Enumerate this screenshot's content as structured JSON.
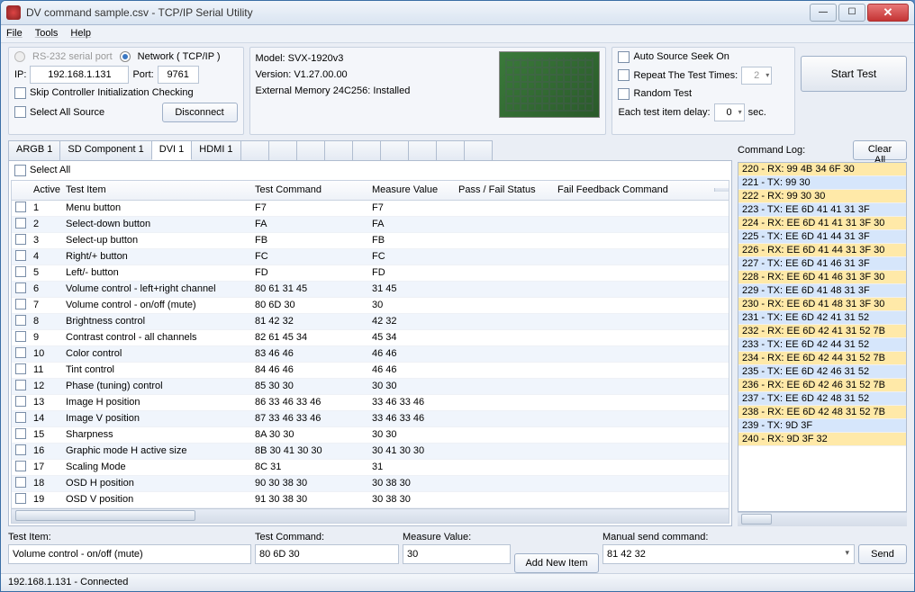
{
  "window": {
    "title": "DV command sample.csv - TCP/IP Serial Utility"
  },
  "menu": {
    "file": "File",
    "tools": "Tools",
    "help": "Help"
  },
  "conn": {
    "rs232": "RS-232 serial port",
    "network": "Network ( TCP/IP )",
    "ip_label": "IP:",
    "ip": "192.168.1.131",
    "port_label": "Port:",
    "port": "9761",
    "skip": "Skip Controller Initialization Checking",
    "selectall_source": "Select All Source",
    "disconnect": "Disconnect"
  },
  "info": {
    "model": "Model: SVX-1920v3",
    "version": "Version: V1.27.00.00",
    "extmem": "External Memory 24C256: Installed"
  },
  "opts": {
    "autoseek": "Auto Source Seek On",
    "repeat": "Repeat The Test Times:",
    "repeat_val": "2",
    "random": "Random Test",
    "delay_label": "Each test item delay:",
    "delay_val": "0",
    "sec": "sec."
  },
  "buttons": {
    "start": "Start Test",
    "clearall": "Clear All",
    "addnew": "Add New Item",
    "send": "Send"
  },
  "tabs": [
    "ARGB 1",
    "SD Component 1",
    "DVI 1",
    "HDMI 1"
  ],
  "active_tab": 2,
  "grid": {
    "selectall": "Select All",
    "headers": {
      "active": "Active",
      "item": "Test Item",
      "cmd": "Test Command",
      "meas": "Measure Value",
      "pass": "Pass / Fail Status",
      "fail": "Fail Feedback Command"
    },
    "rows": [
      {
        "n": "1",
        "item": "Menu button",
        "cmd": "F7",
        "meas": "F7"
      },
      {
        "n": "2",
        "item": "Select-down button",
        "cmd": "FA",
        "meas": "FA"
      },
      {
        "n": "3",
        "item": "Select-up button",
        "cmd": "FB",
        "meas": "FB"
      },
      {
        "n": "4",
        "item": "Right/+ button",
        "cmd": "FC",
        "meas": "FC"
      },
      {
        "n": "5",
        "item": "Left/- button",
        "cmd": "FD",
        "meas": "FD"
      },
      {
        "n": "6",
        "item": "Volume control - left+right channel",
        "cmd": "80 61 31 45",
        "meas": "31 45"
      },
      {
        "n": "7",
        "item": "Volume control - on/off (mute)",
        "cmd": "80 6D 30",
        "meas": "30"
      },
      {
        "n": "8",
        "item": "Brightness control",
        "cmd": "81 42 32",
        "meas": "42 32"
      },
      {
        "n": "9",
        "item": "Contrast control - all channels",
        "cmd": "82 61 45 34",
        "meas": "45 34"
      },
      {
        "n": "10",
        "item": "Color control",
        "cmd": "83 46 46",
        "meas": "46 46"
      },
      {
        "n": "11",
        "item": "Tint control",
        "cmd": "84 46 46",
        "meas": "46 46"
      },
      {
        "n": "12",
        "item": "Phase (tuning) control",
        "cmd": "85 30 30",
        "meas": "30 30"
      },
      {
        "n": "13",
        "item": "Image H position",
        "cmd": "86 33 46 33 46",
        "meas": "33 46 33 46"
      },
      {
        "n": "14",
        "item": "Image V position",
        "cmd": "87 33 46 33 46",
        "meas": "33 46 33 46"
      },
      {
        "n": "15",
        "item": "Sharpness",
        "cmd": "8A 30 30",
        "meas": "30 30"
      },
      {
        "n": "16",
        "item": "Graphic mode H active size",
        "cmd": "8B 30 41 30 30",
        "meas": "30 41 30 30"
      },
      {
        "n": "17",
        "item": "Scaling Mode",
        "cmd": "8C 31",
        "meas": "31"
      },
      {
        "n": "18",
        "item": "OSD H position",
        "cmd": "90 30 38 30",
        "meas": "30 38 30"
      },
      {
        "n": "19",
        "item": "OSD V position",
        "cmd": "91 30 38 30",
        "meas": "30 38 30"
      }
    ]
  },
  "log": {
    "label": "Command Log:",
    "lines": [
      {
        "n": "220",
        "d": "RX",
        "b": "99 4B 34 6F 30"
      },
      {
        "n": "221",
        "d": "TX",
        "b": "99 30"
      },
      {
        "n": "222",
        "d": "RX",
        "b": "99 30 30"
      },
      {
        "n": "223",
        "d": "TX",
        "b": "EE 6D 41 41 31 3F"
      },
      {
        "n": "224",
        "d": "RX",
        "b": "EE 6D 41 41 31 3F 30"
      },
      {
        "n": "225",
        "d": "TX",
        "b": "EE 6D 41 44 31 3F"
      },
      {
        "n": "226",
        "d": "RX",
        "b": "EE 6D 41 44 31 3F 30"
      },
      {
        "n": "227",
        "d": "TX",
        "b": "EE 6D 41 46 31 3F"
      },
      {
        "n": "228",
        "d": "RX",
        "b": "EE 6D 41 46 31 3F 30"
      },
      {
        "n": "229",
        "d": "TX",
        "b": "EE 6D 41 48 31 3F"
      },
      {
        "n": "230",
        "d": "RX",
        "b": "EE 6D 41 48 31 3F 30"
      },
      {
        "n": "231",
        "d": "TX",
        "b": "EE 6D 42 41 31 52"
      },
      {
        "n": "232",
        "d": "RX",
        "b": "EE 6D 42 41 31 52 7B"
      },
      {
        "n": "233",
        "d": "TX",
        "b": "EE 6D 42 44 31 52"
      },
      {
        "n": "234",
        "d": "RX",
        "b": "EE 6D 42 44 31 52 7B"
      },
      {
        "n": "235",
        "d": "TX",
        "b": "EE 6D 42 46 31 52"
      },
      {
        "n": "236",
        "d": "RX",
        "b": "EE 6D 42 46 31 52 7B"
      },
      {
        "n": "237",
        "d": "TX",
        "b": "EE 6D 42 48 31 52"
      },
      {
        "n": "238",
        "d": "RX",
        "b": "EE 6D 42 48 31 52 7B"
      },
      {
        "n": "239",
        "d": "TX",
        "b": "9D 3F"
      },
      {
        "n": "240",
        "d": "RX",
        "b": "9D 3F 32"
      }
    ]
  },
  "bottomform": {
    "testitem_lbl": "Test Item:",
    "testitem_val": "Volume control - on/off (mute)",
    "testcmd_lbl": "Test Command:",
    "testcmd_val": "80 6D 30",
    "meas_lbl": "Measure Value:",
    "meas_val": "30",
    "manual_lbl": "Manual send command:",
    "manual_val": "81 42 32"
  },
  "status": "192.168.1.131 - Connected"
}
